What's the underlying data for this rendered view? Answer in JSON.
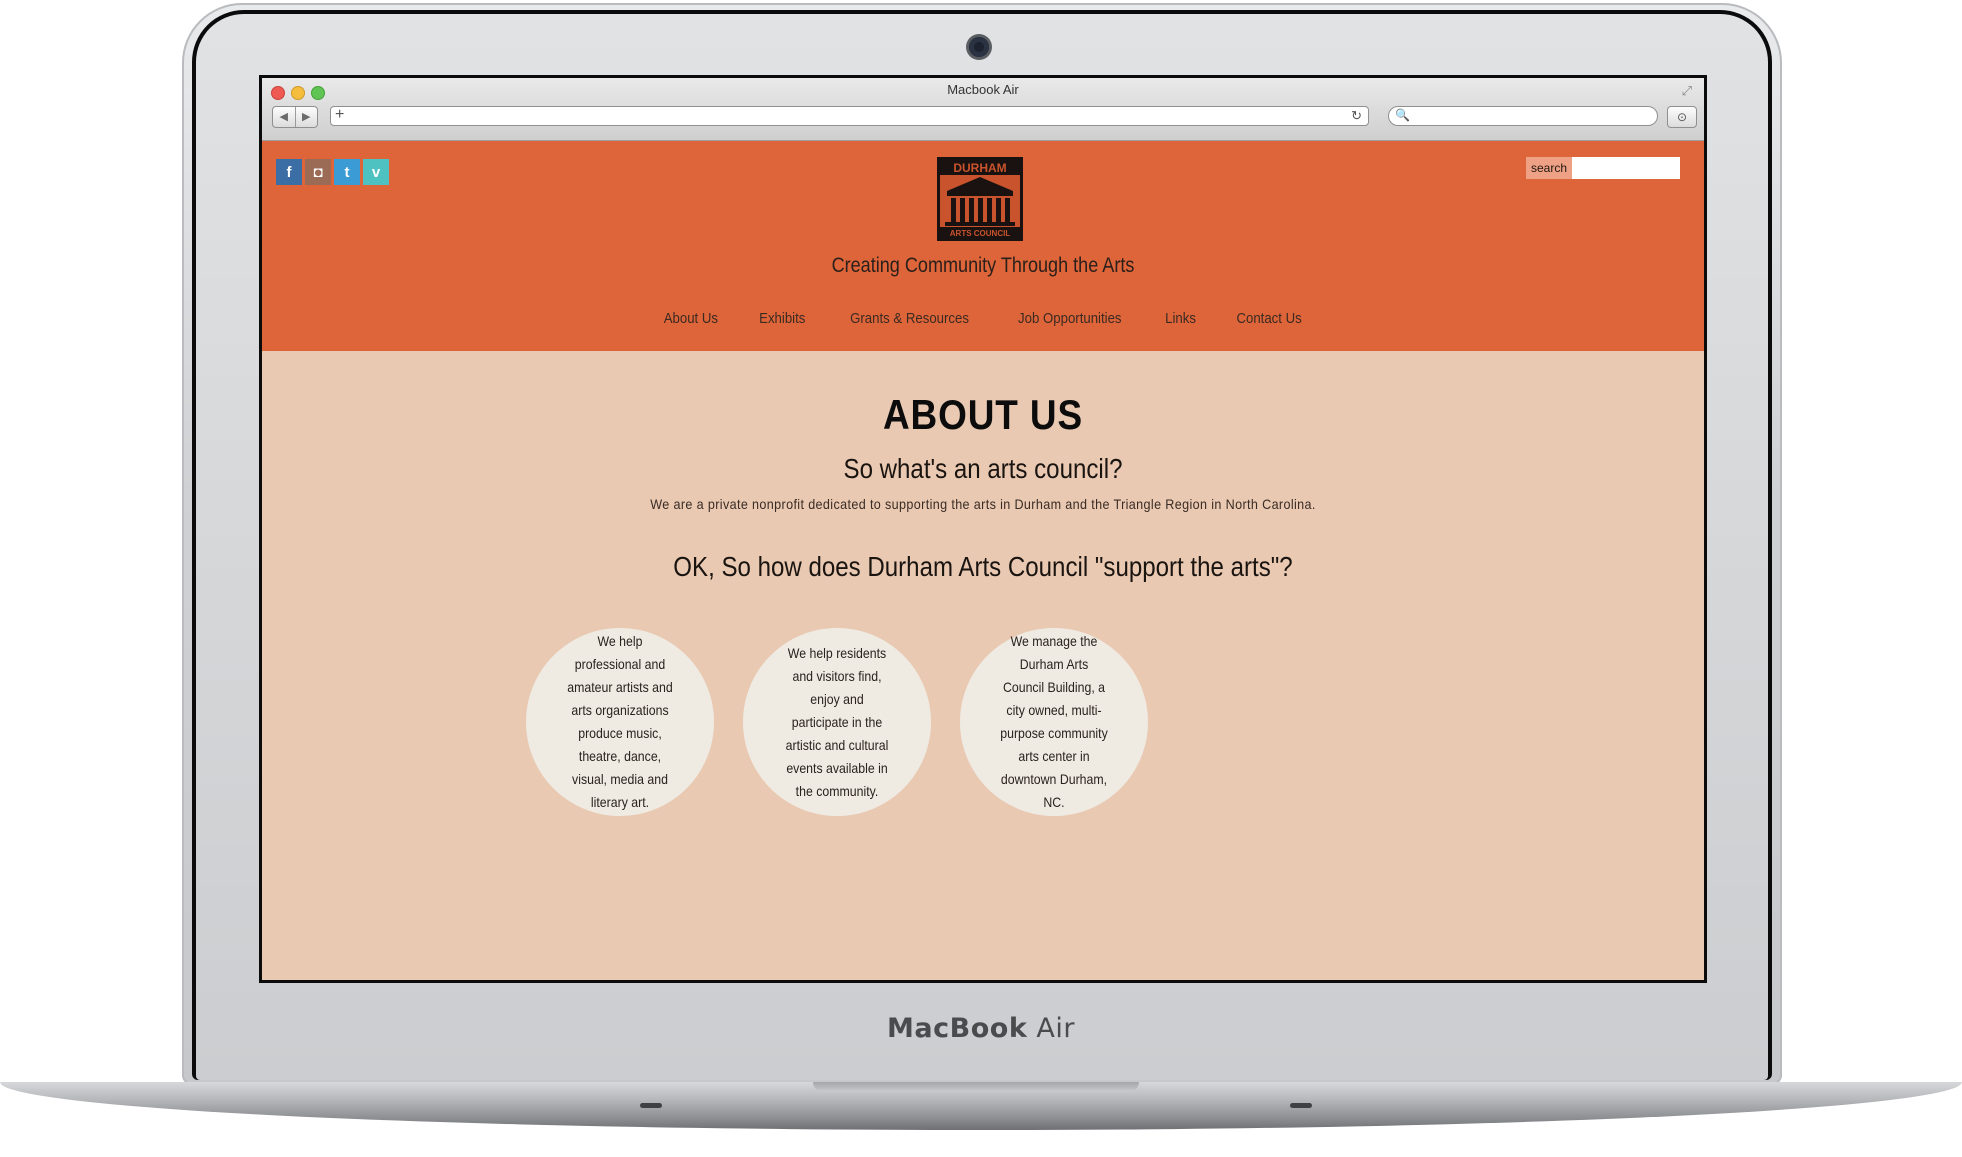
{
  "laptop": {
    "brand_bold": "MacBook",
    "brand_light": " Air"
  },
  "browser": {
    "window_title": "Macbook Air",
    "back_icon": "◀",
    "forward_icon": "▶",
    "new_tab_icon": "+",
    "reload_icon": "↻",
    "search_icon": "🔍",
    "url": "",
    "search_value": ""
  },
  "colors": {
    "header": "#dd6539",
    "page_bg": "#e9c9b2",
    "circle": "#efebe3",
    "search_label_bg": "#eea184"
  },
  "site": {
    "social": [
      {
        "name": "facebook",
        "glyph": "f",
        "color": "#3b6ea5"
      },
      {
        "name": "instagram",
        "glyph": "◘",
        "color": "#9c6b55"
      },
      {
        "name": "twitter",
        "glyph": "t",
        "color": "#3a9bd5"
      },
      {
        "name": "vimeo",
        "glyph": "v",
        "color": "#4ec2c0"
      }
    ],
    "tagline": "Creating Community Through the Arts",
    "search_label": "search",
    "search_value": "",
    "nav": [
      "About Us",
      "Exhibits",
      "Grants & Resources",
      "Job Opportunities",
      "Links",
      "Contact Us"
    ]
  },
  "content": {
    "title": "ABOUT US",
    "question1": "So what's an arts council?",
    "answer1": "We are a private nonprofit dedicated to supporting the arts in Durham and the Triangle Region in North Carolina.",
    "question2": "OK, So how does Durham Arts Council \"support the arts\"?",
    "circles": [
      "We help professional and amateur artists and arts organizations produce music, theatre, dance, visual, media and literary art.",
      "We help residents and visitors find, enjoy and participate in the artistic and cultural events available in the community.",
      "We manage the Durham Arts Council Building, a city owned, multi-purpose community arts center in downtown Durham, NC."
    ]
  }
}
